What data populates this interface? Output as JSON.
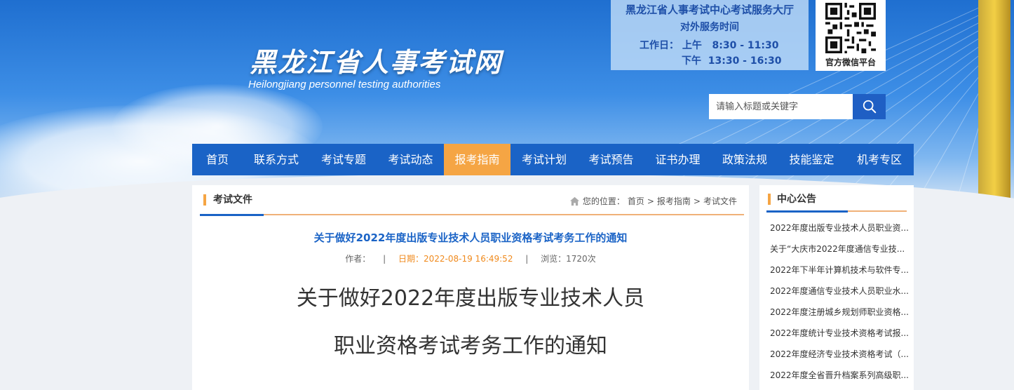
{
  "header": {
    "site_title": "黑龙江省人事考试网",
    "site_subtitle": "Heilongjiang personnel testing authorities"
  },
  "hours": {
    "title": "黑龙江省人事考试中心考试服务大厅",
    "subtitle": "对外服务时间",
    "workday_label": "工作日：",
    "am": "上午   8:30 - 11:30",
    "pm": "下午  13:30 - 16:30"
  },
  "qr": {
    "label": "官方微信平台"
  },
  "search": {
    "placeholder": "请输入标题或关键字"
  },
  "nav": {
    "items": [
      "首页",
      "联系方式",
      "考试专题",
      "考试动态",
      "报考指南",
      "考试计划",
      "考试预告",
      "证书办理",
      "政策法规",
      "技能鉴定",
      "机考专区"
    ],
    "active_index": 4
  },
  "main": {
    "section_title": "考试文件",
    "breadcrumb": {
      "prefix": "您的位置：",
      "items": [
        "首页",
        "报考指南",
        "考试文件"
      ],
      "sep": ">"
    },
    "article_title": "关于做好2022年度出版专业技术人员职业资格考试考务工作的通知",
    "meta": {
      "author": "作者：",
      "date": "日期：2022-08-19 16:49:52",
      "views": "浏览：1720次"
    },
    "heading_line1": "关于做好2022年度出版专业技术人员",
    "heading_line2": "职业资格考试考务工作的通知"
  },
  "sidebar": {
    "title": "中心公告",
    "items": [
      "2022年度出版专业技术人员职业资...",
      "关于“大庆市2022年度通信专业技...",
      "2022年下半年计算机技术与软件专...",
      "2022年度通信专业技术人员职业水...",
      "2022年度注册城乡规划师职业资格...",
      "2022年度统计专业技术资格考试报...",
      "2022年度经济专业技术资格考试（...",
      "2022年度全省晋升档案系列高级职..."
    ]
  },
  "colors": {
    "nav_bg": "#1a63c6",
    "nav_active": "#f5a544",
    "accent_orange": "#f5a544",
    "title_blue": "#1a63c6"
  }
}
